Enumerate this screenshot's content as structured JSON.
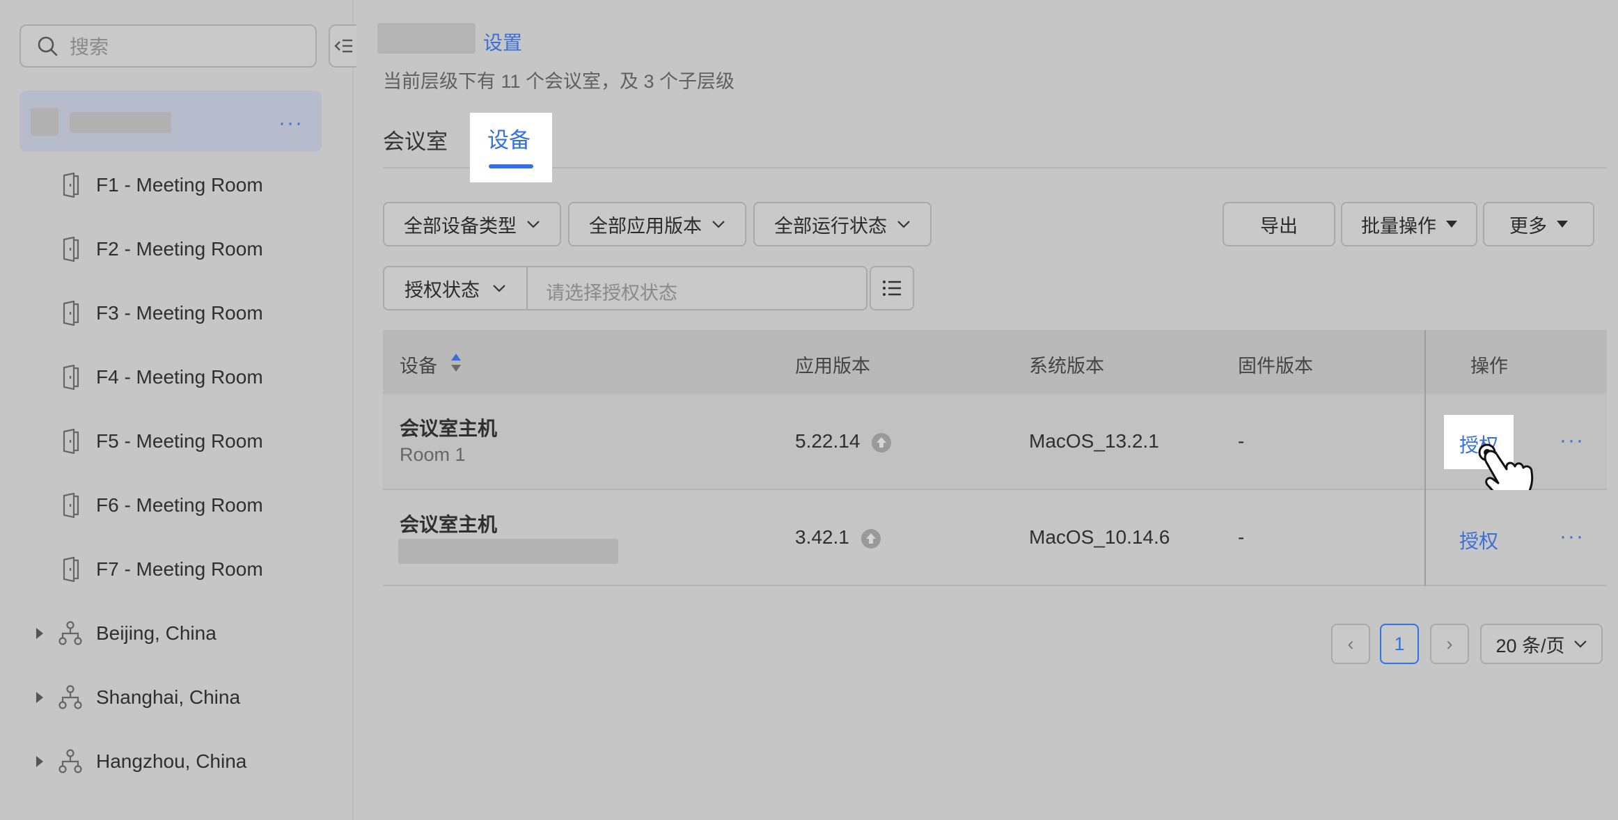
{
  "sidebar": {
    "search_placeholder": "搜索",
    "root_more": "···",
    "rooms": [
      {
        "label": "F1 - Meeting Room"
      },
      {
        "label": "F2 - Meeting Room"
      },
      {
        "label": "F3 - Meeting Room"
      },
      {
        "label": "F4 - Meeting Room"
      },
      {
        "label": "F5 - Meeting Room"
      },
      {
        "label": "F6 - Meeting Room"
      },
      {
        "label": "F7 - Meeting Room"
      }
    ],
    "groups": [
      {
        "label": "Beijing, China"
      },
      {
        "label": "Shanghai, China"
      },
      {
        "label": "Hangzhou, China"
      }
    ]
  },
  "header": {
    "crumb_link": "设置",
    "subtitle": "当前层级下有 11 个会议室，及 3 个子层级"
  },
  "tabs": {
    "rooms": "会议室",
    "devices": "设备"
  },
  "filters": {
    "device_type": "全部设备类型",
    "app_version": "全部应用版本",
    "run_status": "全部运行状态",
    "auth_status": "授权状态",
    "auth_placeholder": "请选择授权状态"
  },
  "toolbar": {
    "export": "导出",
    "batch": "批量操作",
    "more": "更多"
  },
  "table": {
    "headers": {
      "device": "设备",
      "app_version": "应用版本",
      "system_version": "系统版本",
      "firmware_version": "固件版本",
      "actions": "操作"
    },
    "rows": [
      {
        "name": "会议室主机",
        "sub": "Room 1",
        "app_version": "5.22.14",
        "system_version": "MacOS_13.2.1",
        "firmware": "-",
        "action": "授权",
        "more": "···"
      },
      {
        "name": "会议室主机",
        "sub": "",
        "app_version": "3.42.1",
        "system_version": "MacOS_10.14.6",
        "firmware": "-",
        "action": "授权",
        "more": "···"
      }
    ]
  },
  "pagination": {
    "prev": "‹",
    "page": "1",
    "next": "›",
    "page_size": "20 条/页"
  },
  "colors": {
    "accent": "#3370e6",
    "link": "#3c6fd8"
  }
}
